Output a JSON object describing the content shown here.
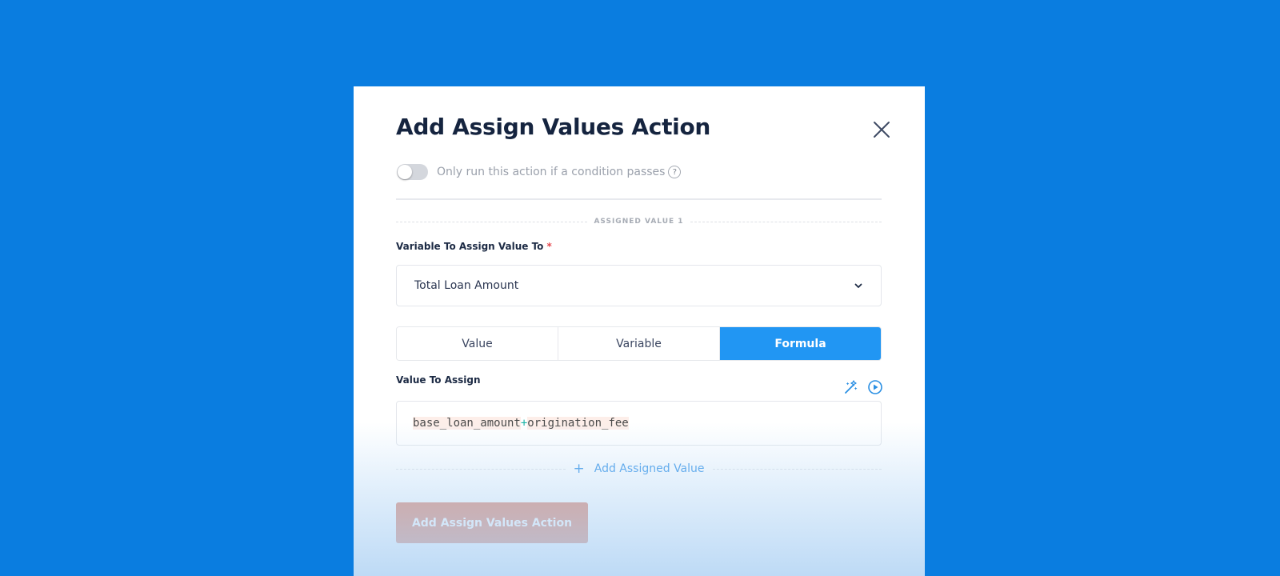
{
  "modal": {
    "title": "Add Assign Values Action",
    "close_icon": "close-icon"
  },
  "condition": {
    "enabled": false,
    "label": "Only run this action if a condition passes",
    "help": "?"
  },
  "assigned_values": [
    {
      "section_label": "ASSIGNED VALUE 1",
      "variable_label": "Variable To Assign Value To",
      "required_mark": "*",
      "variable_selected": "Total Loan Amount",
      "mode_options": [
        "Value",
        "Variable",
        "Formula"
      ],
      "mode_selected": "Formula",
      "value_label": "Value To Assign",
      "formula_tokens": [
        {
          "type": "variable",
          "text": "base_loan_amount"
        },
        {
          "type": "operator",
          "text": "+"
        },
        {
          "type": "variable",
          "text": "origination_fee"
        }
      ]
    }
  ],
  "tools": [
    "magic-wand-icon",
    "play-circle-icon"
  ],
  "add_assigned_value": {
    "icon": "+",
    "label": "Add Assigned Value"
  },
  "submit_label": "Add Assign Values Action",
  "colors": {
    "background": "#0a7de0",
    "accent": "#2196f3",
    "primary_button": "#d96a4c",
    "title": "#15243f"
  }
}
